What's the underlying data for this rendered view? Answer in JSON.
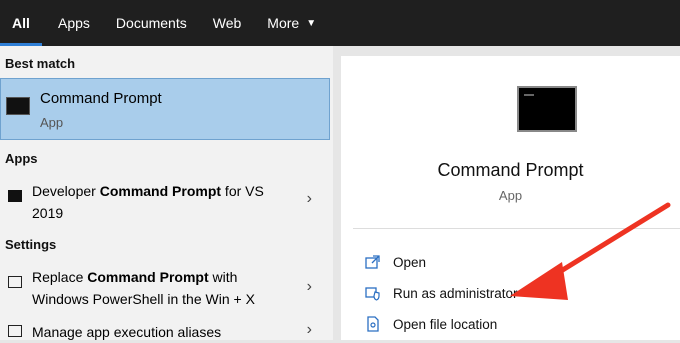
{
  "tabs": [
    {
      "label": "All",
      "active": true
    },
    {
      "label": "Apps",
      "active": false
    },
    {
      "label": "Documents",
      "active": false
    },
    {
      "label": "Web",
      "active": false
    },
    {
      "label": "More",
      "active": false
    }
  ],
  "left": {
    "best_match_header": "Best match",
    "best_match": {
      "title": "Command Prompt",
      "subtitle": "App"
    },
    "apps_header": "Apps",
    "apps": [
      {
        "prefix": "Developer ",
        "bold": "Command Prompt",
        "suffix": " for VS 2019",
        "icon": "terminal-icon"
      }
    ],
    "settings_header": "Settings",
    "settings": [
      {
        "prefix": "Replace ",
        "bold": "Command Prompt",
        "suffix": " with Windows PowerShell in the Win + X",
        "icon": "settings-window-icon"
      },
      {
        "prefix": "Manage app execution aliases",
        "bold": "",
        "suffix": "",
        "icon": "settings-list-icon"
      }
    ]
  },
  "right": {
    "title": "Command Prompt",
    "subtitle": "App",
    "actions": [
      {
        "label": "Open",
        "icon": "open-icon"
      },
      {
        "label": "Run as administrator",
        "icon": "shield-icon"
      },
      {
        "label": "Open file location",
        "icon": "file-location-icon"
      }
    ]
  },
  "colors": {
    "accent": "#2f7fd6",
    "selection": "#a9cdeb",
    "annotation_arrow": "#ee3322"
  }
}
